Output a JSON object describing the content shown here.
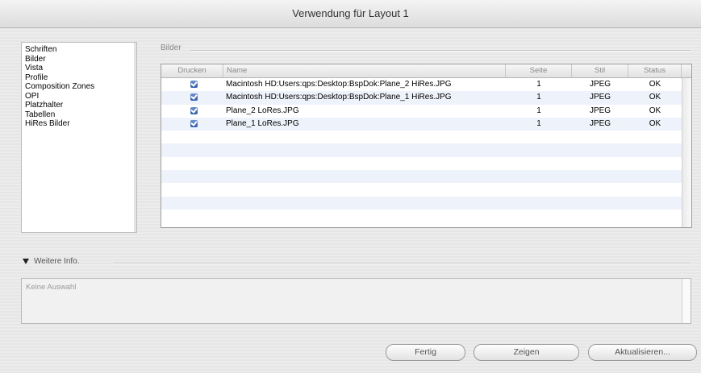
{
  "window": {
    "title": "Verwendung für Layout 1"
  },
  "sidebar": {
    "items": [
      {
        "label": "Schriften"
      },
      {
        "label": "Bilder"
      },
      {
        "label": "Vista"
      },
      {
        "label": "Profile"
      },
      {
        "label": "Composition Zones"
      },
      {
        "label": "OPI"
      },
      {
        "label": "Platzhalter"
      },
      {
        "label": "Tabellen"
      },
      {
        "label": "HiRes Bilder"
      }
    ]
  },
  "main": {
    "section_title": "Bilder",
    "table": {
      "columns": [
        "Drucken",
        "Name",
        "Seite",
        "Stil",
        "Status"
      ],
      "rows": [
        {
          "print": true,
          "name": "Macintosh HD:Users:qps:Desktop:BspDok:Plane_2 HiRes.JPG",
          "page": "1",
          "style": "JPEG",
          "status": "OK"
        },
        {
          "print": true,
          "name": "Macintosh HD:Users:qps:Desktop:BspDok:Plane_1 HiRes.JPG",
          "page": "1",
          "style": "JPEG",
          "status": "OK"
        },
        {
          "print": true,
          "name": "Plane_2 LoRes.JPG",
          "page": "1",
          "style": "JPEG",
          "status": "OK"
        },
        {
          "print": true,
          "name": "Plane_1 LoRes.JPG",
          "page": "1",
          "style": "JPEG",
          "status": "OK"
        }
      ],
      "empty_rows": 7
    }
  },
  "more_info": {
    "label": "Weitere Info.",
    "text": "Keine Auswahl"
  },
  "buttons": {
    "done": "Fertig",
    "show": "Zeigen",
    "refresh": "Aktualisieren..."
  },
  "colors": {
    "checkbox": "#3a63b0",
    "alt_row": "#eef2fa"
  }
}
